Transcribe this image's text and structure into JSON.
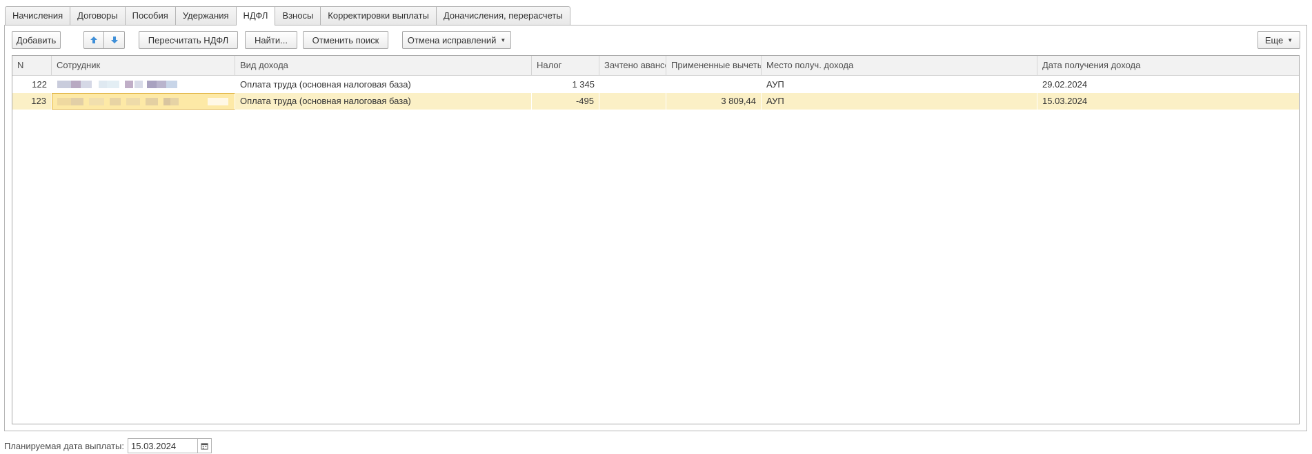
{
  "tabs": [
    {
      "label": "Начисления",
      "active": false
    },
    {
      "label": "Договоры",
      "active": false
    },
    {
      "label": "Пособия",
      "active": false
    },
    {
      "label": "Удержания",
      "active": false
    },
    {
      "label": "НДФЛ",
      "active": true
    },
    {
      "label": "Взносы",
      "active": false
    },
    {
      "label": "Корректировки выплаты",
      "active": false
    },
    {
      "label": "Доначисления, перерасчеты",
      "active": false
    }
  ],
  "toolbar": {
    "add_label": "Добавить",
    "move_up_icon": "arrow-up-icon",
    "move_down_icon": "arrow-down-icon",
    "recalc_label": "Пересчитать НДФЛ",
    "find_label": "Найти...",
    "cancel_search_label": "Отменить поиск",
    "cancel_corrections_label": "Отмена исправлений",
    "more_label": "Еще"
  },
  "table": {
    "columns": [
      "N",
      "Сотрудник",
      "Вид дохода",
      "Налог",
      "Зачтено авансов",
      "Примененные вычеты",
      "Место получ. дохода",
      "Дата получения дохода"
    ],
    "rows": [
      {
        "n": "122",
        "employee": "",
        "income_type": "Оплата труда (основная налоговая база)",
        "tax": "1 345",
        "advances": "",
        "deductions": "",
        "place": "АУП",
        "date": "29.02.2024",
        "selected": false
      },
      {
        "n": "123",
        "employee": "",
        "income_type": "Оплата труда (основная налоговая база)",
        "tax": "-495",
        "advances": "",
        "deductions": "3 809,44",
        "place": "АУП",
        "date": "15.03.2024",
        "selected": true
      }
    ]
  },
  "bottom": {
    "planned_date_label": "Планируемая дата выплаты:",
    "planned_date_value": "15.03.2024",
    "calendar_icon": "calendar-icon"
  },
  "colors": {
    "selected_row": "#fbf0c6",
    "focus_cell": "#fde9a6",
    "arrow_blue": "#3f8fd8"
  }
}
